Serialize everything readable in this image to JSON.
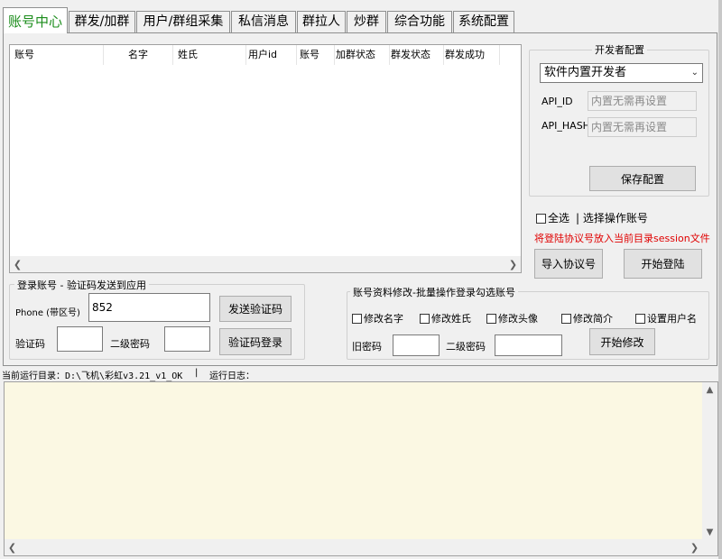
{
  "tabs": [
    {
      "label": "账号中心",
      "active": true
    },
    {
      "label": "群发/加群"
    },
    {
      "label": "用户/群组采集"
    },
    {
      "label": "私信消息"
    },
    {
      "label": "群拉人"
    },
    {
      "label": "炒群"
    },
    {
      "label": "综合功能"
    },
    {
      "label": "系统配置"
    }
  ],
  "account_table": {
    "columns": [
      "账号",
      "名字",
      "姓氏",
      "用户id",
      "账号",
      "加群状态",
      "群发状态",
      "群发成功"
    ]
  },
  "dev_config": {
    "title": "开发者配置",
    "select_value": "软件内置开发者",
    "api_id_label": "API_ID",
    "api_id_placeholder": "内置无需再设置",
    "api_hash_label": "API_HASH",
    "api_hash_placeholder": "内置无需再设置",
    "save_button": "保存配置"
  },
  "select_all_label": "全选",
  "select_hint": "| 选择操作账号",
  "session_hint": "将登陆协议号放入当前目录session文件",
  "import_button": "导入协议号",
  "start_login_button": "开始登陆",
  "login_group": {
    "title": "登录账号 - 验证码发送到应用",
    "phone_label": "Phone (带区号)",
    "phone_value": "852",
    "send_code_button": "发送验证码",
    "code_label": "验证码",
    "code_value": "",
    "second_pwd_label": "二级密码",
    "second_pwd_value": "",
    "code_login_button": "验证码登录"
  },
  "modify_group": {
    "title": "账号资料修改-批量操作登录勾选账号",
    "options": [
      "修改名字",
      "修改姓氏",
      "修改头像",
      "修改简介",
      "设置用户名"
    ],
    "old_pwd_label": "旧密码",
    "old_pwd_value": "",
    "second_pwd_label": "二级密码",
    "second_pwd_value": "",
    "start_button": "开始修改"
  },
  "status_bar": {
    "dir_label": "当前运行目录：D:\\飞机\\彩虹v3.21_v1_OK",
    "separator": "|",
    "log_label": "运行日志："
  },
  "colors": {
    "active_tab_text": "#1a8c1a",
    "hint_red": "#e00000",
    "log_bg": "#fbf8e3"
  }
}
